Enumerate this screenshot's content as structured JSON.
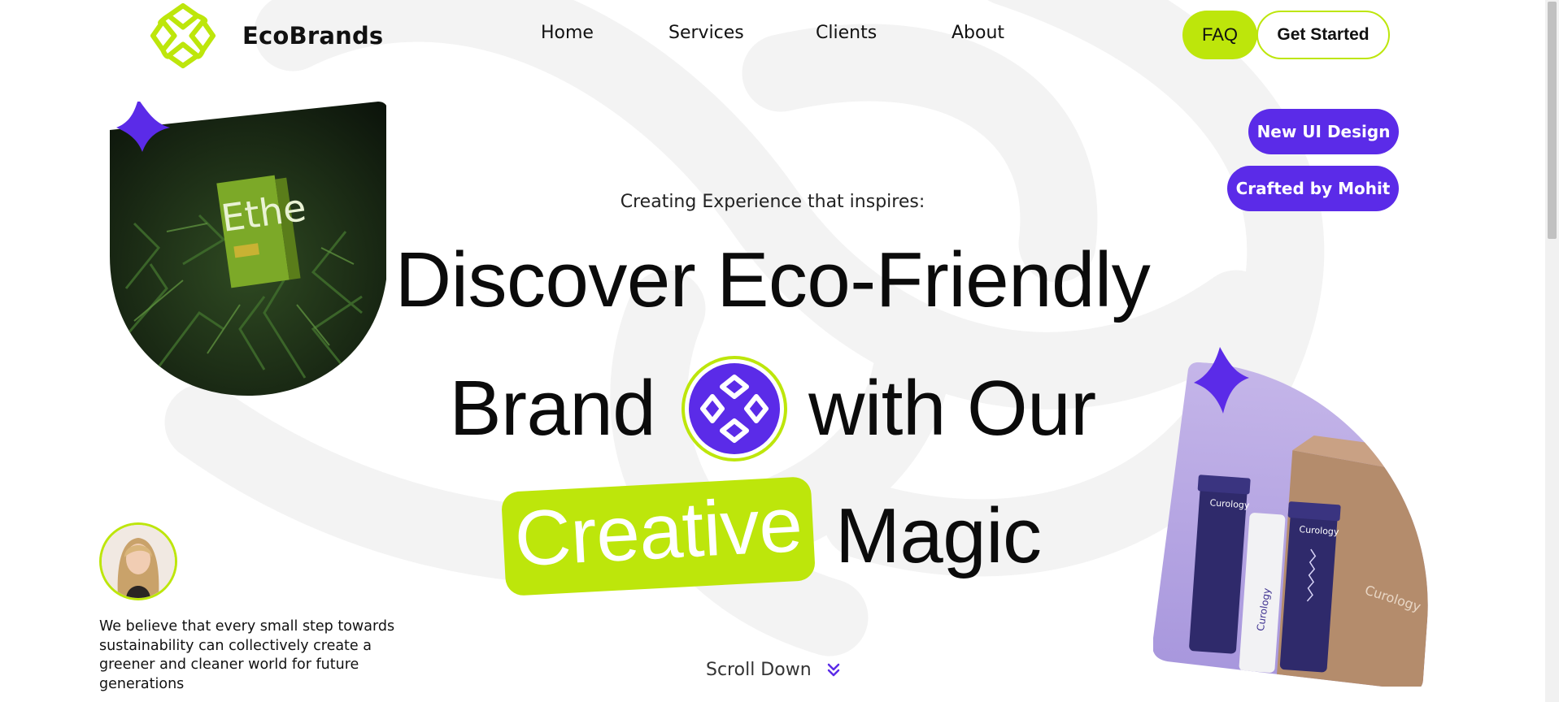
{
  "brand": {
    "name": "EcoBrands",
    "logo_icon": "eco-knot-icon",
    "accent_color": "#bde60b",
    "secondary_color": "#5b2be8"
  },
  "nav": {
    "items": [
      {
        "label": "Home"
      },
      {
        "label": "Services"
      },
      {
        "label": "Clients"
      },
      {
        "label": "About"
      }
    ]
  },
  "header": {
    "faq_label": "FAQ",
    "cta_label": "Get Started"
  },
  "tags": [
    "New UI Design",
    "Crafted by Mohit"
  ],
  "hero": {
    "subtitle": "Creating Experience that inspires:",
    "line1": "Discover Eco-Friendly",
    "line2_a": "Brand",
    "line2_b": "with Our",
    "line3_highlight": "Creative",
    "line3_rest": "Magic"
  },
  "product_left": {
    "label": "Ethe"
  },
  "product_right": {
    "brand": "Curology"
  },
  "testimonial": {
    "quote": "We believe that every small step towards sustainability can collectively create a greener and cleaner world for future generations"
  },
  "scroll": {
    "label": "Scroll Down",
    "icon": "double-chevron-down-icon"
  }
}
